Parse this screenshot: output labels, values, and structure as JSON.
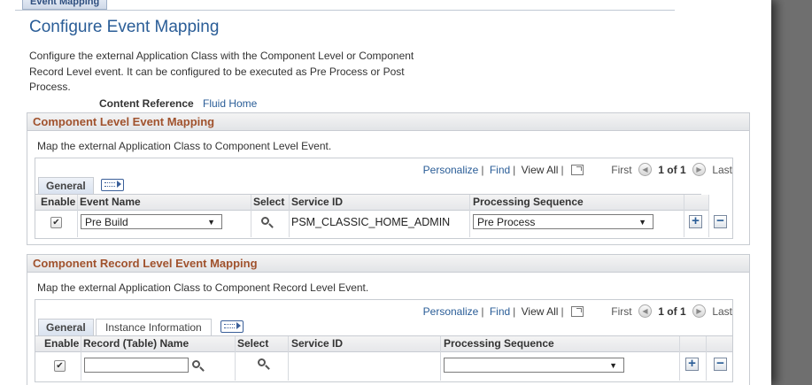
{
  "top_tab": "Event Mapping",
  "page_title": "Configure Event Mapping",
  "intro_text": "Configure the external Application Class with the Component Level or Component Record Level event. It can be configured to be executed as Pre Process or Post Process.",
  "content_reference": {
    "label": "Content Reference",
    "value": "Fluid Home"
  },
  "component_level": {
    "title": "Component Level Event Mapping",
    "description": "Map the external Application Class to Component Level Event.",
    "nav": {
      "personalize": "Personalize",
      "find": "Find",
      "view_all": "View All",
      "first": "First",
      "range": "1 of 1",
      "last": "Last"
    },
    "tabs": [
      "General"
    ],
    "columns": {
      "enable": "Enable",
      "event_name": "Event Name",
      "select": "Select",
      "service_id": "Service ID",
      "processing_sequence": "Processing Sequence"
    },
    "rows": [
      {
        "enabled": "✔",
        "event_name": "Pre Build",
        "service_id": "PSM_CLASSIC_HOME_ADMIN",
        "processing_sequence": "Pre Process"
      }
    ]
  },
  "component_record_level": {
    "title": "Component Record Level Event Mapping",
    "description": "Map the external Application Class to Component Record Level Event.",
    "nav": {
      "personalize": "Personalize",
      "find": "Find",
      "view_all": "View All",
      "first": "First",
      "range": "1 of 1",
      "last": "Last"
    },
    "tabs": [
      "General",
      "Instance Information"
    ],
    "columns": {
      "enable": "Enable",
      "record_name": "Record (Table) Name",
      "select": "Select",
      "service_id": "Service ID",
      "processing_sequence": "Processing Sequence"
    },
    "rows": [
      {
        "enabled": "✔",
        "record_name": "",
        "service_id": "",
        "processing_sequence": ""
      }
    ]
  },
  "icons": {
    "magnifier": "search-icon",
    "popout": "popout-icon",
    "show_all_columns": "show-all-columns-icon",
    "nav_prev": "previous-icon",
    "nav_next": "next-icon",
    "add_row": "add-row-icon",
    "delete_row": "delete-row-icon"
  },
  "symbols": {
    "add": "+",
    "delete": "−",
    "dropdown_arrow": "▼",
    "prev": "◀",
    "next": "▶"
  },
  "colors": {
    "title": "#2a5d97",
    "section_header_text": "#a0522d",
    "link": "#2a5d97"
  }
}
